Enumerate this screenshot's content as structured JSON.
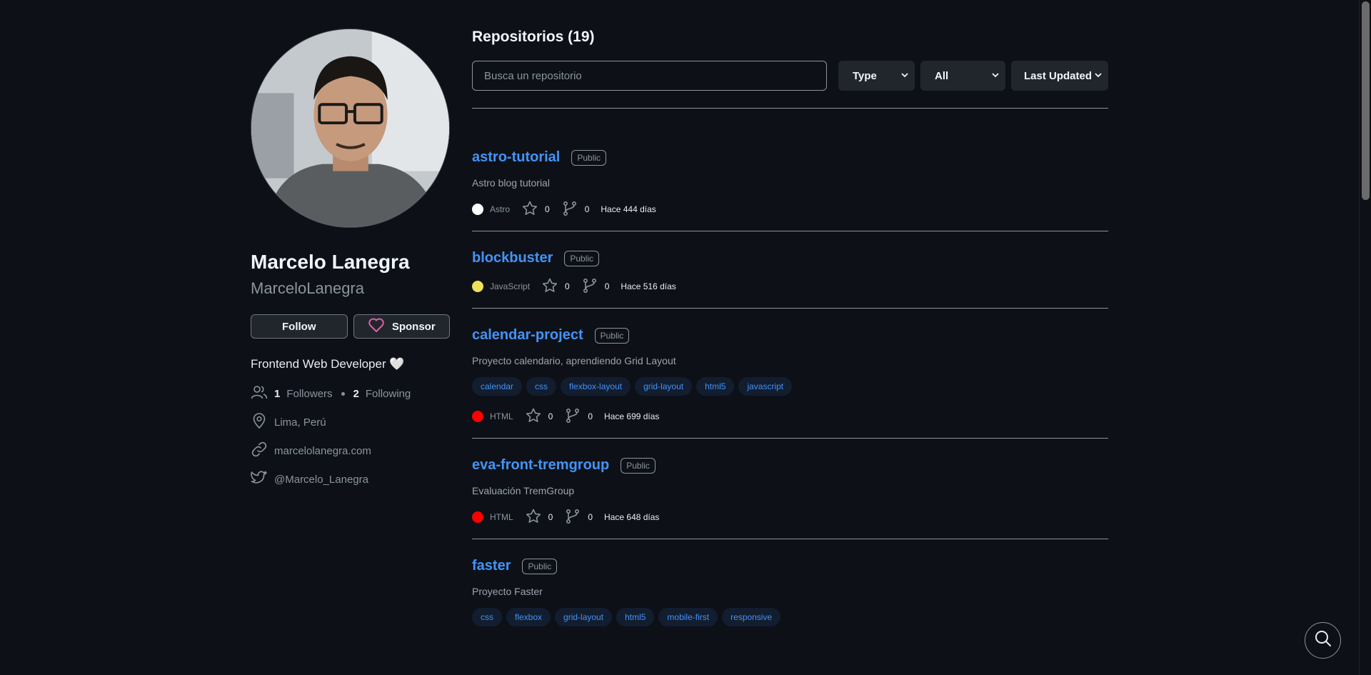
{
  "profile": {
    "name": "Marcelo Lanegra",
    "login": "MarceloLanegra",
    "follow_label": "Follow",
    "sponsor_label": "Sponsor",
    "bio": "Frontend Web Developer 🤍",
    "followers_count": "1",
    "followers_label": "Followers",
    "following_count": "2",
    "following_label": "Following",
    "location": "Lima, Perú",
    "website": "marcelolanegra.com",
    "twitter": "@Marcelo_Lanegra"
  },
  "repos_header": {
    "title": "Repositorios (19)",
    "search_placeholder": "Busca un repositorio",
    "type_select": "Type",
    "all_select": "All",
    "sort_select": "Last Updated"
  },
  "repos": [
    {
      "name": "astro-tutorial",
      "visibility": "Public",
      "description": "Astro blog tutorial",
      "topics": [],
      "language": "Astro",
      "language_color": "#ffffff",
      "stars": "0",
      "forks": "0",
      "updated": "Hace 444 días"
    },
    {
      "name": "blockbuster",
      "visibility": "Public",
      "description": "",
      "topics": [],
      "language": "JavaScript",
      "language_color": "#f1e05a",
      "stars": "0",
      "forks": "0",
      "updated": "Hace 516 días"
    },
    {
      "name": "calendar-project",
      "visibility": "Public",
      "description": "Proyecto calendario, aprendiendo Grid Layout",
      "topics": [
        "calendar",
        "css",
        "flexbox-layout",
        "grid-layout",
        "html5",
        "javascript"
      ],
      "language": "HTML",
      "language_color": "#ff0000",
      "stars": "0",
      "forks": "0",
      "updated": "Hace 699 días"
    },
    {
      "name": "eva-front-tremgroup",
      "visibility": "Public",
      "description": "Evaluación TremGroup",
      "topics": [],
      "language": "HTML",
      "language_color": "#ff0000",
      "stars": "0",
      "forks": "0",
      "updated": "Hace 648 días"
    },
    {
      "name": "faster",
      "visibility": "Public",
      "description": "Proyecto Faster",
      "topics": [
        "css",
        "flexbox",
        "grid-layout",
        "html5",
        "mobile-first",
        "responsive"
      ],
      "language": "",
      "language_color": "",
      "stars": "",
      "forks": "",
      "updated": ""
    }
  ],
  "colors": {
    "background": "#0d1117",
    "link": "#4493f8",
    "muted": "#8b949e",
    "topic_bg": "#121d2f"
  },
  "icons": {
    "people": "people-icon",
    "location": "location-icon",
    "link": "link-icon",
    "twitter": "twitter-icon",
    "heart": "heart-icon",
    "star": "star-icon",
    "fork": "fork-icon",
    "search": "search-icon"
  }
}
